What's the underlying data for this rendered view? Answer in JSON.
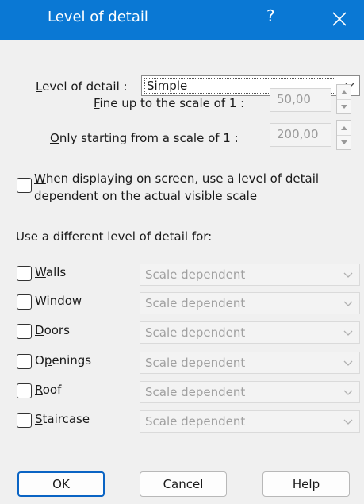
{
  "window": {
    "title": "Level of detail",
    "help_glyph": "?"
  },
  "detail": {
    "label_prefix": "L",
    "label_rest": "evel of detail :",
    "value": "Simple"
  },
  "fine": {
    "label_prefix": "F",
    "label_rest": "ine up to the scale of 1 :",
    "value": "50,00"
  },
  "only": {
    "label_prefix": "O",
    "label_rest": "nly starting from a scale of 1  :",
    "value": "200,00"
  },
  "screen_option": {
    "line1_prefix": "W",
    "line1_rest": "hen displaying on screen, use a level of detail",
    "line2": "dependent on the actual visible scale",
    "checked": false
  },
  "different_section": {
    "heading": "Use a different level of detail for:"
  },
  "elements": [
    {
      "pre": "",
      "acc": "W",
      "post": "alls",
      "value": "Scale dependent"
    },
    {
      "pre": "W",
      "acc": "i",
      "post": "ndow",
      "value": "Scale dependent"
    },
    {
      "pre": "",
      "acc": "D",
      "post": "oors",
      "value": "Scale dependent"
    },
    {
      "pre": "O",
      "acc": "p",
      "post": "enings",
      "value": "Scale dependent"
    },
    {
      "pre": "",
      "acc": "R",
      "post": "oof",
      "value": "Scale dependent"
    },
    {
      "pre": "",
      "acc": "S",
      "post": "taircase",
      "value": "Scale dependent"
    }
  ],
  "buttons": {
    "ok": "OK",
    "cancel": "Cancel",
    "help": "Help"
  },
  "colors": {
    "titlebar": "#0a78d4",
    "background": "#f0f0f0",
    "default_button_border": "#0a64c4"
  }
}
